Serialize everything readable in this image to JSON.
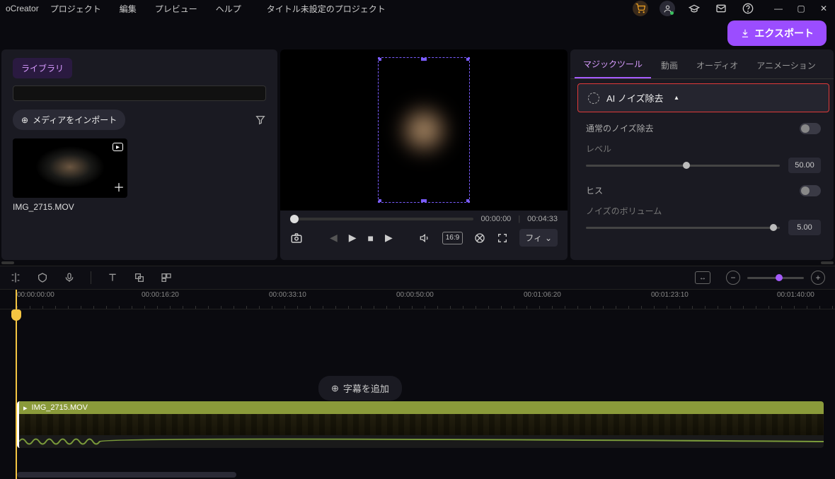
{
  "app_name": "oCreator",
  "menus": [
    "プロジェクト",
    "編集",
    "プレビュー",
    "ヘルプ"
  ],
  "project_title": "タイトル未設定のプロジェクト",
  "export_label": "エクスポート",
  "library": {
    "tab_label": "ライブラリ",
    "import_label": "メディアをインポート",
    "items": [
      {
        "name": "IMG_2715.MOV"
      }
    ]
  },
  "preview": {
    "current_time": "00:00:00",
    "total_time": "00:04:33",
    "aspect_label": "16:9",
    "fit_label": "フィ"
  },
  "right_panel": {
    "tabs": [
      "マジックツール",
      "動画",
      "オーディオ",
      "アニメーション"
    ],
    "active_tab": 0,
    "ai_denoise_label": "AI ノイズ除去",
    "normal_denoise_label": "通常のノイズ除去",
    "level_label": "レベル",
    "level_value": "50.00",
    "hiss_label": "ヒス",
    "noise_volume_label": "ノイズのボリューム",
    "noise_volume_value": "5.00"
  },
  "timeline": {
    "ruler_marks": [
      "00:00:00:00",
      "00:00:16:20",
      "00:00:33:10",
      "00:00:50:00",
      "00:01:06:20",
      "00:01:23:10",
      "00:01:40:00"
    ],
    "subtitle_prompt": "字幕を追加",
    "clip_name": "IMG_2715.MOV"
  }
}
